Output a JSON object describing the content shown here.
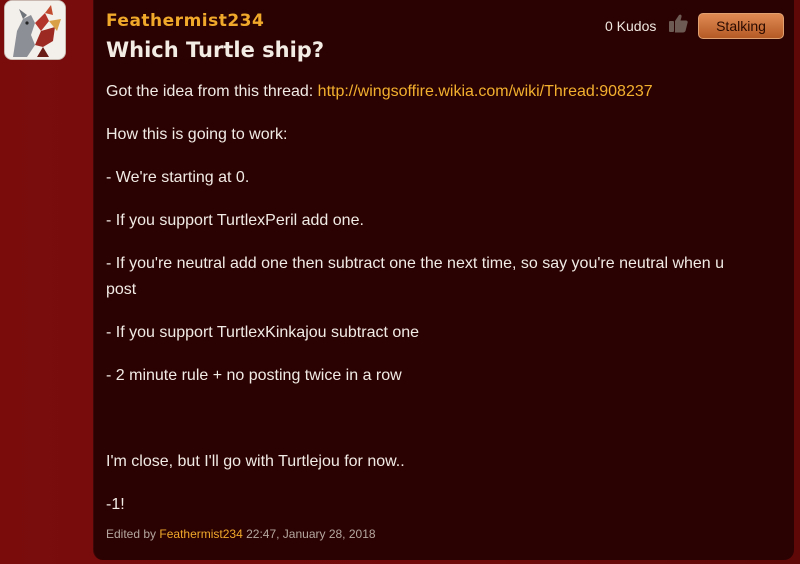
{
  "post": {
    "username": "Feathermist234",
    "title": "Which Turtle ship?",
    "kudos_label": "0 Kudos",
    "stalk_button": "Stalking",
    "line1_prefix": "Got the idea from this thread: ",
    "thread_link": "http://wingsoffire.wikia.com/wiki/Thread:908237",
    "how": "How this is going to work:",
    "rule1": "- We're starting at 0.",
    "rule2": "- If you support TurtlexPeril add one.",
    "rule3_a": "- If you're neutral add one then subtract one the next time, so say you're neutral when u",
    "rule3_b": "post",
    "rule4": "- If you support TurtlexKinkajou subtract one",
    "rule5": "- 2 minute rule + no posting twice in a row",
    "reply": "I'm close, but I'll go with Turtlejou for now..",
    "count": "-1!",
    "edited_prefix": "Edited by",
    "edited_user": "Feathermist234",
    "edited_time": "22:47, January 28, 2018"
  },
  "icons": {
    "avatar": "dragon-avatar",
    "kudos": "thumbs-up-icon"
  },
  "colors": {
    "page_bg": "#7a0c0c",
    "post_bg": "#2b0202",
    "accent": "#f0a92a",
    "button": "#d0773f"
  }
}
